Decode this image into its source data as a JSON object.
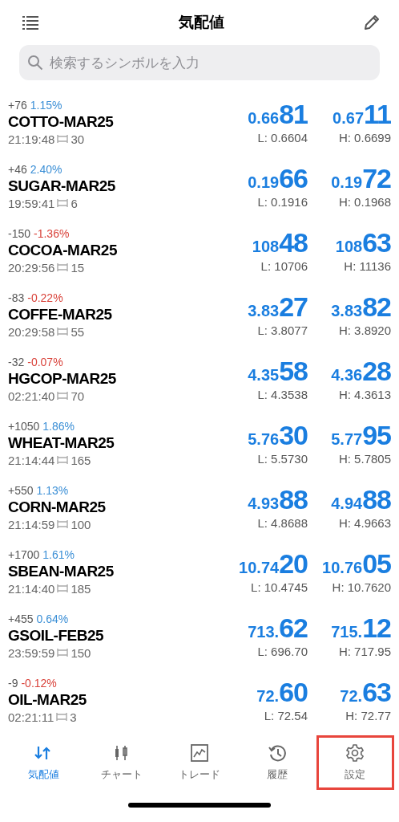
{
  "header": {
    "title": "気配値"
  },
  "search": {
    "placeholder": "検索するシンボルを入力"
  },
  "quotes": [
    {
      "change": "+76",
      "percent": "1.15%",
      "negative": false,
      "symbol": "COTTO-MAR25",
      "time": "21:19:48",
      "spread": "30",
      "bid": {
        "small": "0.66",
        "big": "81"
      },
      "ask": {
        "small": "0.67",
        "big": "11"
      },
      "low": "L: 0.6604",
      "high": "H: 0.6699"
    },
    {
      "change": "+46",
      "percent": "2.40%",
      "negative": false,
      "symbol": "SUGAR-MAR25",
      "time": "19:59:41",
      "spread": "6",
      "bid": {
        "small": "0.19",
        "big": "66"
      },
      "ask": {
        "small": "0.19",
        "big": "72"
      },
      "low": "L: 0.1916",
      "high": "H: 0.1968"
    },
    {
      "change": "-150",
      "percent": "-1.36%",
      "negative": true,
      "symbol": "COCOA-MAR25",
      "time": "20:29:56",
      "spread": "15",
      "bid": {
        "small": "108",
        "big": "48"
      },
      "ask": {
        "small": "108",
        "big": "63"
      },
      "low": "L: 10706",
      "high": "H: 11136"
    },
    {
      "change": "-83",
      "percent": "-0.22%",
      "negative": true,
      "symbol": "COFFE-MAR25",
      "time": "20:29:58",
      "spread": "55",
      "bid": {
        "small": "3.83",
        "big": "27"
      },
      "ask": {
        "small": "3.83",
        "big": "82"
      },
      "low": "L: 3.8077",
      "high": "H: 3.8920"
    },
    {
      "change": "-32",
      "percent": "-0.07%",
      "negative": true,
      "symbol": "HGCOP-MAR25",
      "time": "02:21:40",
      "spread": "70",
      "bid": {
        "small": "4.35",
        "big": "58"
      },
      "ask": {
        "small": "4.36",
        "big": "28"
      },
      "low": "L: 4.3538",
      "high": "H: 4.3613"
    },
    {
      "change": "+1050",
      "percent": "1.86%",
      "negative": false,
      "symbol": "WHEAT-MAR25",
      "time": "21:14:44",
      "spread": "165",
      "bid": {
        "small": "5.76",
        "big": "30"
      },
      "ask": {
        "small": "5.77",
        "big": "95"
      },
      "low": "L: 5.5730",
      "high": "H: 5.7805"
    },
    {
      "change": "+550",
      "percent": "1.13%",
      "negative": false,
      "symbol": "CORN-MAR25",
      "time": "21:14:59",
      "spread": "100",
      "bid": {
        "small": "4.93",
        "big": "88"
      },
      "ask": {
        "small": "4.94",
        "big": "88"
      },
      "low": "L: 4.8688",
      "high": "H: 4.9663"
    },
    {
      "change": "+1700",
      "percent": "1.61%",
      "negative": false,
      "symbol": "SBEAN-MAR25",
      "time": "21:14:40",
      "spread": "185",
      "bid": {
        "small": "10.74",
        "big": "20"
      },
      "ask": {
        "small": "10.76",
        "big": "05"
      },
      "low": "L: 10.4745",
      "high": "H: 10.7620"
    },
    {
      "change": "+455",
      "percent": "0.64%",
      "negative": false,
      "symbol": "GSOIL-FEB25",
      "time": "23:59:59",
      "spread": "150",
      "bid": {
        "small": "713.",
        "big": "62"
      },
      "ask": {
        "small": "715.",
        "big": "12"
      },
      "low": "L: 696.70",
      "high": "H: 717.95"
    },
    {
      "change": "-9",
      "percent": "-0.12%",
      "negative": true,
      "symbol": "OIL-MAR25",
      "time": "02:21:11",
      "spread": "3",
      "bid": {
        "small": "72.",
        "big": "60"
      },
      "ask": {
        "small": "72.",
        "big": "63"
      },
      "low": "L: 72.54",
      "high": "H: 72.77"
    }
  ],
  "tabs": [
    {
      "label": "気配値",
      "kind": "quotes",
      "selected": true,
      "highlighted": false
    },
    {
      "label": "チャート",
      "kind": "chart",
      "selected": false,
      "highlighted": false
    },
    {
      "label": "トレード",
      "kind": "trade",
      "selected": false,
      "highlighted": false
    },
    {
      "label": "履歴",
      "kind": "history",
      "selected": false,
      "highlighted": false
    },
    {
      "label": "設定",
      "kind": "settings",
      "selected": false,
      "highlighted": true
    }
  ]
}
